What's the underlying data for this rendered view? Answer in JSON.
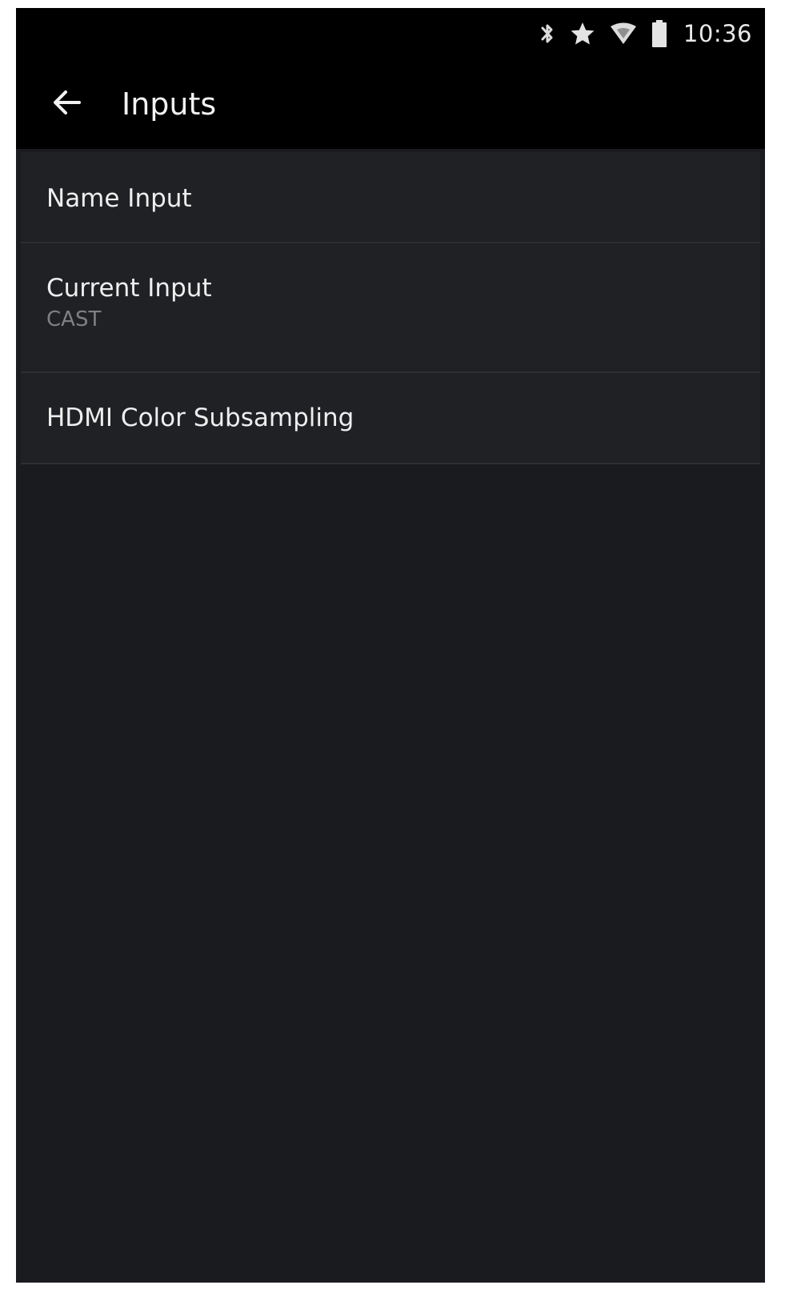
{
  "status_bar": {
    "icons": [
      "bluetooth-icon",
      "star-icon",
      "wifi-icon",
      "battery-icon"
    ],
    "time": "10:36"
  },
  "app_bar": {
    "back_icon": "arrow-left-icon",
    "title": "Inputs"
  },
  "settings": {
    "items": [
      {
        "title": "Name Input"
      },
      {
        "title": "Current Input",
        "subtitle": "CAST"
      },
      {
        "title": "HDMI Color Subsampling"
      }
    ]
  },
  "colors": {
    "top_bar": "#000000",
    "background": "#1a1b1e",
    "list_item": "#1f2124",
    "divider": "#2c2e32",
    "primary_text": "#eeeeee",
    "secondary_text": "#7e8084"
  }
}
